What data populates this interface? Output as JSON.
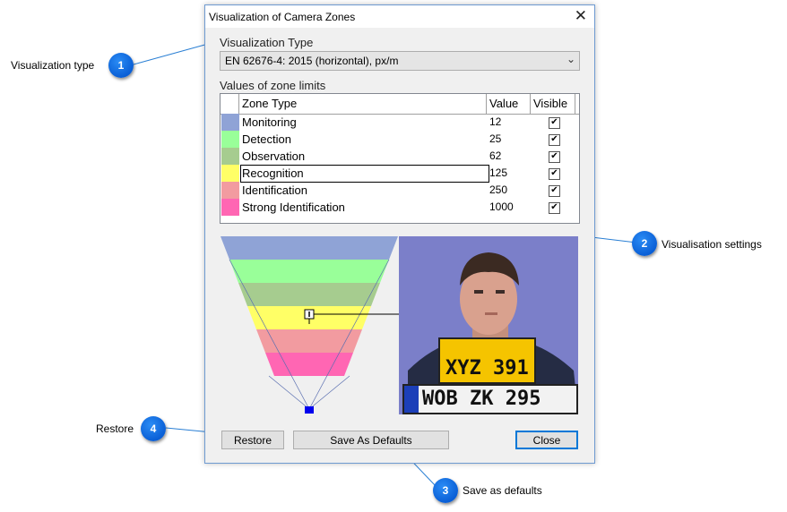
{
  "dialog": {
    "title": "Visualization of Camera Zones",
    "visualization_type_label": "Visualization Type",
    "visualization_type_value": "EN 62676-4: 2015 (horizontal), px/m",
    "zone_limits_label": "Values of zone limits",
    "columns": [
      "Zone Type",
      "Value",
      "Visible"
    ],
    "zones": [
      {
        "name": "Monitoring",
        "value": "12",
        "visible": true,
        "color": "#8fa3d6"
      },
      {
        "name": "Detection",
        "value": "25",
        "visible": true,
        "color": "#99ff99"
      },
      {
        "name": "Observation",
        "value": "62",
        "visible": true,
        "color": "#a6cc8f"
      },
      {
        "name": "Recognition",
        "value": "125",
        "visible": true,
        "color": "#ffff66"
      },
      {
        "name": "Identification",
        "value": "250",
        "visible": true,
        "color": "#f29ba0"
      },
      {
        "name": "Strong Identification",
        "value": "1000",
        "visible": true,
        "color": "#ff66b3"
      }
    ],
    "plate_yellow": "XYZ 391",
    "plate_white": "WOB ZK 295",
    "buttons": {
      "restore": "Restore",
      "save_defaults": "Save As Defaults",
      "close": "Close"
    }
  },
  "callouts": [
    {
      "number": "1",
      "label": "Visualization type"
    },
    {
      "number": "2",
      "label": "Visualisation settings"
    },
    {
      "number": "3",
      "label": "Save as defaults"
    },
    {
      "number": "4",
      "label": "Restore"
    }
  ]
}
